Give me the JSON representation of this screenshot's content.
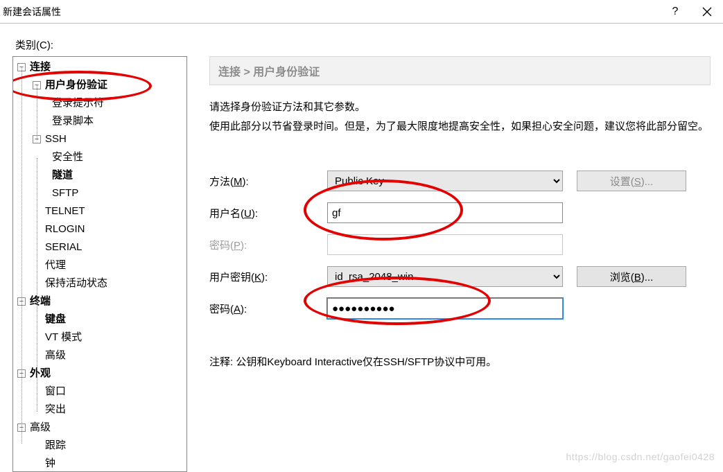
{
  "window": {
    "title": "新建会话属性",
    "help": "?",
    "close": "×"
  },
  "category_label": "类别(C):",
  "tree": {
    "n0": "连接",
    "n0_0": "用户身份验证",
    "n0_0_0": "登录提示符",
    "n0_0_1": "登录脚本",
    "n0_1": "SSH",
    "n0_1_0": "安全性",
    "n0_1_1": "隧道",
    "n0_1_2": "SFTP",
    "n0_2": "TELNET",
    "n0_3": "RLOGIN",
    "n0_4": "SERIAL",
    "n0_5": "代理",
    "n0_6": "保持活动状态",
    "n1": "终端",
    "n1_0": "键盘",
    "n1_1": "VT 模式",
    "n1_2": "高级",
    "n2": "外观",
    "n2_0": "窗口",
    "n2_1": "突出",
    "n3": "高级",
    "n3_0": "跟踪",
    "n3_1": "钟"
  },
  "breadcrumb": "连接 > 用户身份验证",
  "desc_line1": "请选择身份验证方法和其它参数。",
  "desc_line2": "使用此部分以节省登录时间。但是，为了最大限度地提高安全性，如果担心安全问题，建议您将此部分留空。",
  "labels": {
    "method": "方法(M):",
    "username": "用户名(U):",
    "password": "密码(P):",
    "userkey": "用户密钥(K):",
    "passphrase": "密码(A):"
  },
  "values": {
    "method": "Public Key",
    "username": "gf",
    "password": "",
    "userkey": "id_rsa_2048_win",
    "passphrase": "●●●●●●●●●●"
  },
  "buttons": {
    "setup": "设置(S)...",
    "browse": "浏览(B)..."
  },
  "note": "注释: 公钥和Keyboard Interactive仅在SSH/SFTP协议中可用。",
  "watermark": "https://blog.csdn.net/gaofei0428"
}
